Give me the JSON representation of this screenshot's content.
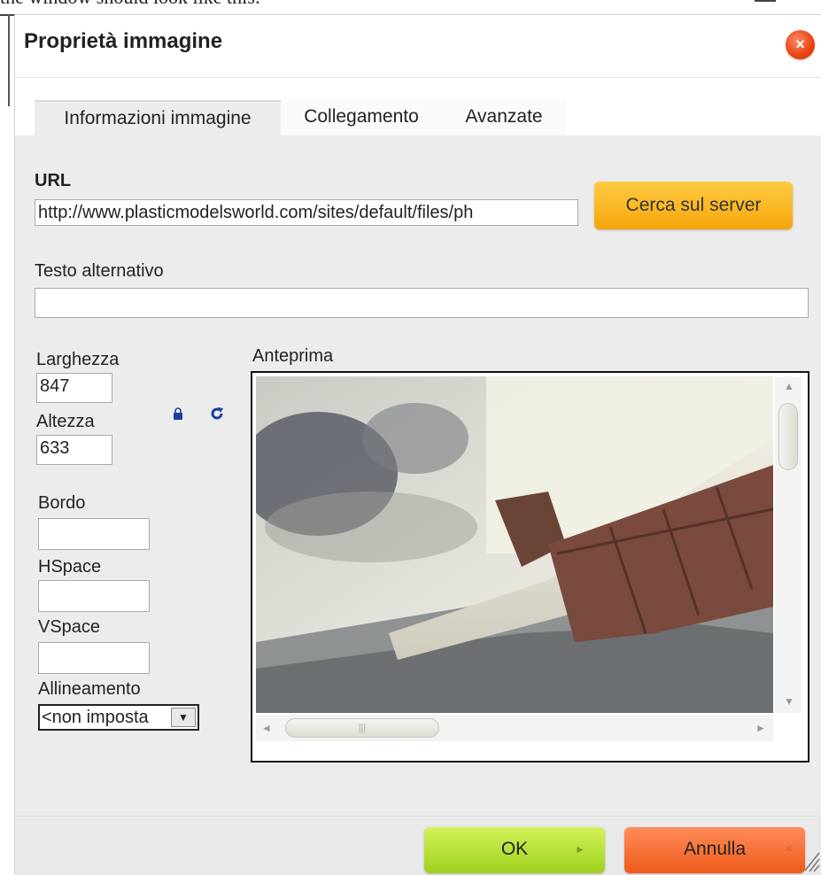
{
  "background": {
    "caption": "the window should look like this:"
  },
  "dialog": {
    "title": "Proprietà immagine",
    "close_icon": "close-icon"
  },
  "tabs": [
    {
      "label": "Informazioni immagine",
      "active": true
    },
    {
      "label": "Collegamento",
      "active": false
    },
    {
      "label": "Avanzate",
      "active": false
    }
  ],
  "url": {
    "label": "URL",
    "value": "http://www.plasticmodelsworld.com/sites/default/files/ph"
  },
  "browse_server": {
    "label": "Cerca sul server"
  },
  "alt_text": {
    "label": "Testo alternativo",
    "value": ""
  },
  "width": {
    "label": "Larghezza",
    "value": "847"
  },
  "height": {
    "label": "Altezza",
    "value": "633"
  },
  "border": {
    "label": "Bordo",
    "value": ""
  },
  "hspace": {
    "label": "HSpace",
    "value": ""
  },
  "vspace": {
    "label": "VSpace",
    "value": ""
  },
  "align": {
    "label": "Allineamento",
    "value": "<non imposta"
  },
  "preview": {
    "label": "Anteprima"
  },
  "footer": {
    "ok_label": "OK",
    "cancel_label": "Annulla"
  },
  "colors": {
    "ok_green": "#a6d420",
    "cancel_orange": "#f06020",
    "server_yellow": "#f8b020",
    "close_red": "#e8420f",
    "lock_blue": "#1a3fa0"
  }
}
